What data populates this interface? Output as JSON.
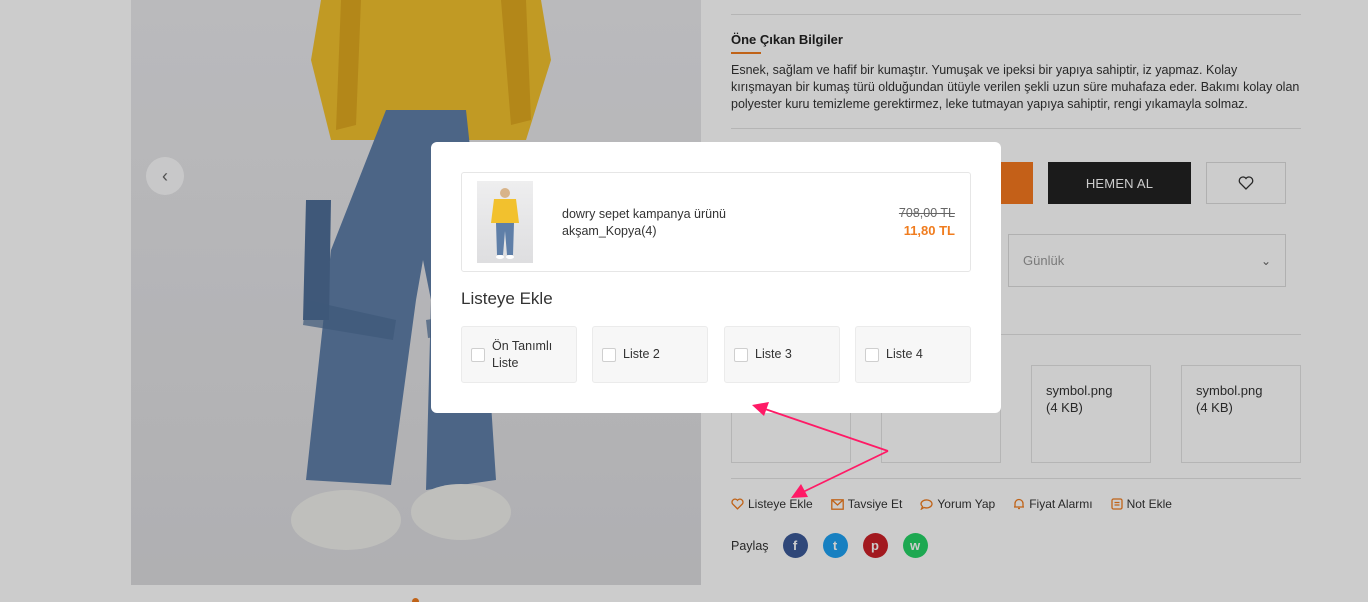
{
  "product_info": {
    "section_title": "Öne Çıkan Bilgiler",
    "description": "Esnek, sağlam ve hafif bir kumaştır. Yumuşak ve ipeksi bir yapıya sahiptir, iz yapmaz. Kolay kırışmayan bir kumaş türü olduğundan ütüyle verilen şekli uzun süre muhafaza eder. Bakımı kolay olan polyester kuru temizleme gerektirmez, leke tutmayan yapıya sahiptir, rengi yıkamayla solmaz."
  },
  "buttons": {
    "buy_now": "HEMEN AL"
  },
  "select": {
    "value": "Günlük"
  },
  "files": [
    {
      "name": "symbol.png",
      "size": "(4 KB)"
    },
    {
      "name": "symbol.png",
      "size": "(4 KB)"
    }
  ],
  "actions": [
    {
      "label": "Listeye Ekle",
      "icon": "heart-icon"
    },
    {
      "label": "Tavsiye Et",
      "icon": "envelope-icon"
    },
    {
      "label": "Yorum Yap",
      "icon": "comment-icon"
    },
    {
      "label": "Fiyat Alarmı",
      "icon": "bell-icon"
    },
    {
      "label": "Not Ekle",
      "icon": "note-icon"
    }
  ],
  "share": {
    "label": "Paylaş",
    "networks": [
      {
        "icon": "facebook-icon",
        "glyph": "f",
        "color": "#3b5998"
      },
      {
        "icon": "twitter-icon",
        "glyph": "t",
        "color": "#1da1f2"
      },
      {
        "icon": "pinterest-icon",
        "glyph": "p",
        "color": "#cb2027"
      },
      {
        "icon": "whatsapp-icon",
        "glyph": "w",
        "color": "#25d366"
      }
    ]
  },
  "modal": {
    "product_name": "dowry sepet kampanya ürünü akşam_Kopya(4)",
    "old_price": "708,00 TL",
    "new_price": "11,80 TL",
    "title": "Listeye Ekle",
    "lists": [
      "Ön Tanımlı Liste",
      "Liste 2",
      "Liste 3",
      "Liste 4"
    ]
  },
  "colors": {
    "accent": "#f07c1e",
    "annotation_arrow": "#ff1a66",
    "buy_button": "#222222"
  }
}
